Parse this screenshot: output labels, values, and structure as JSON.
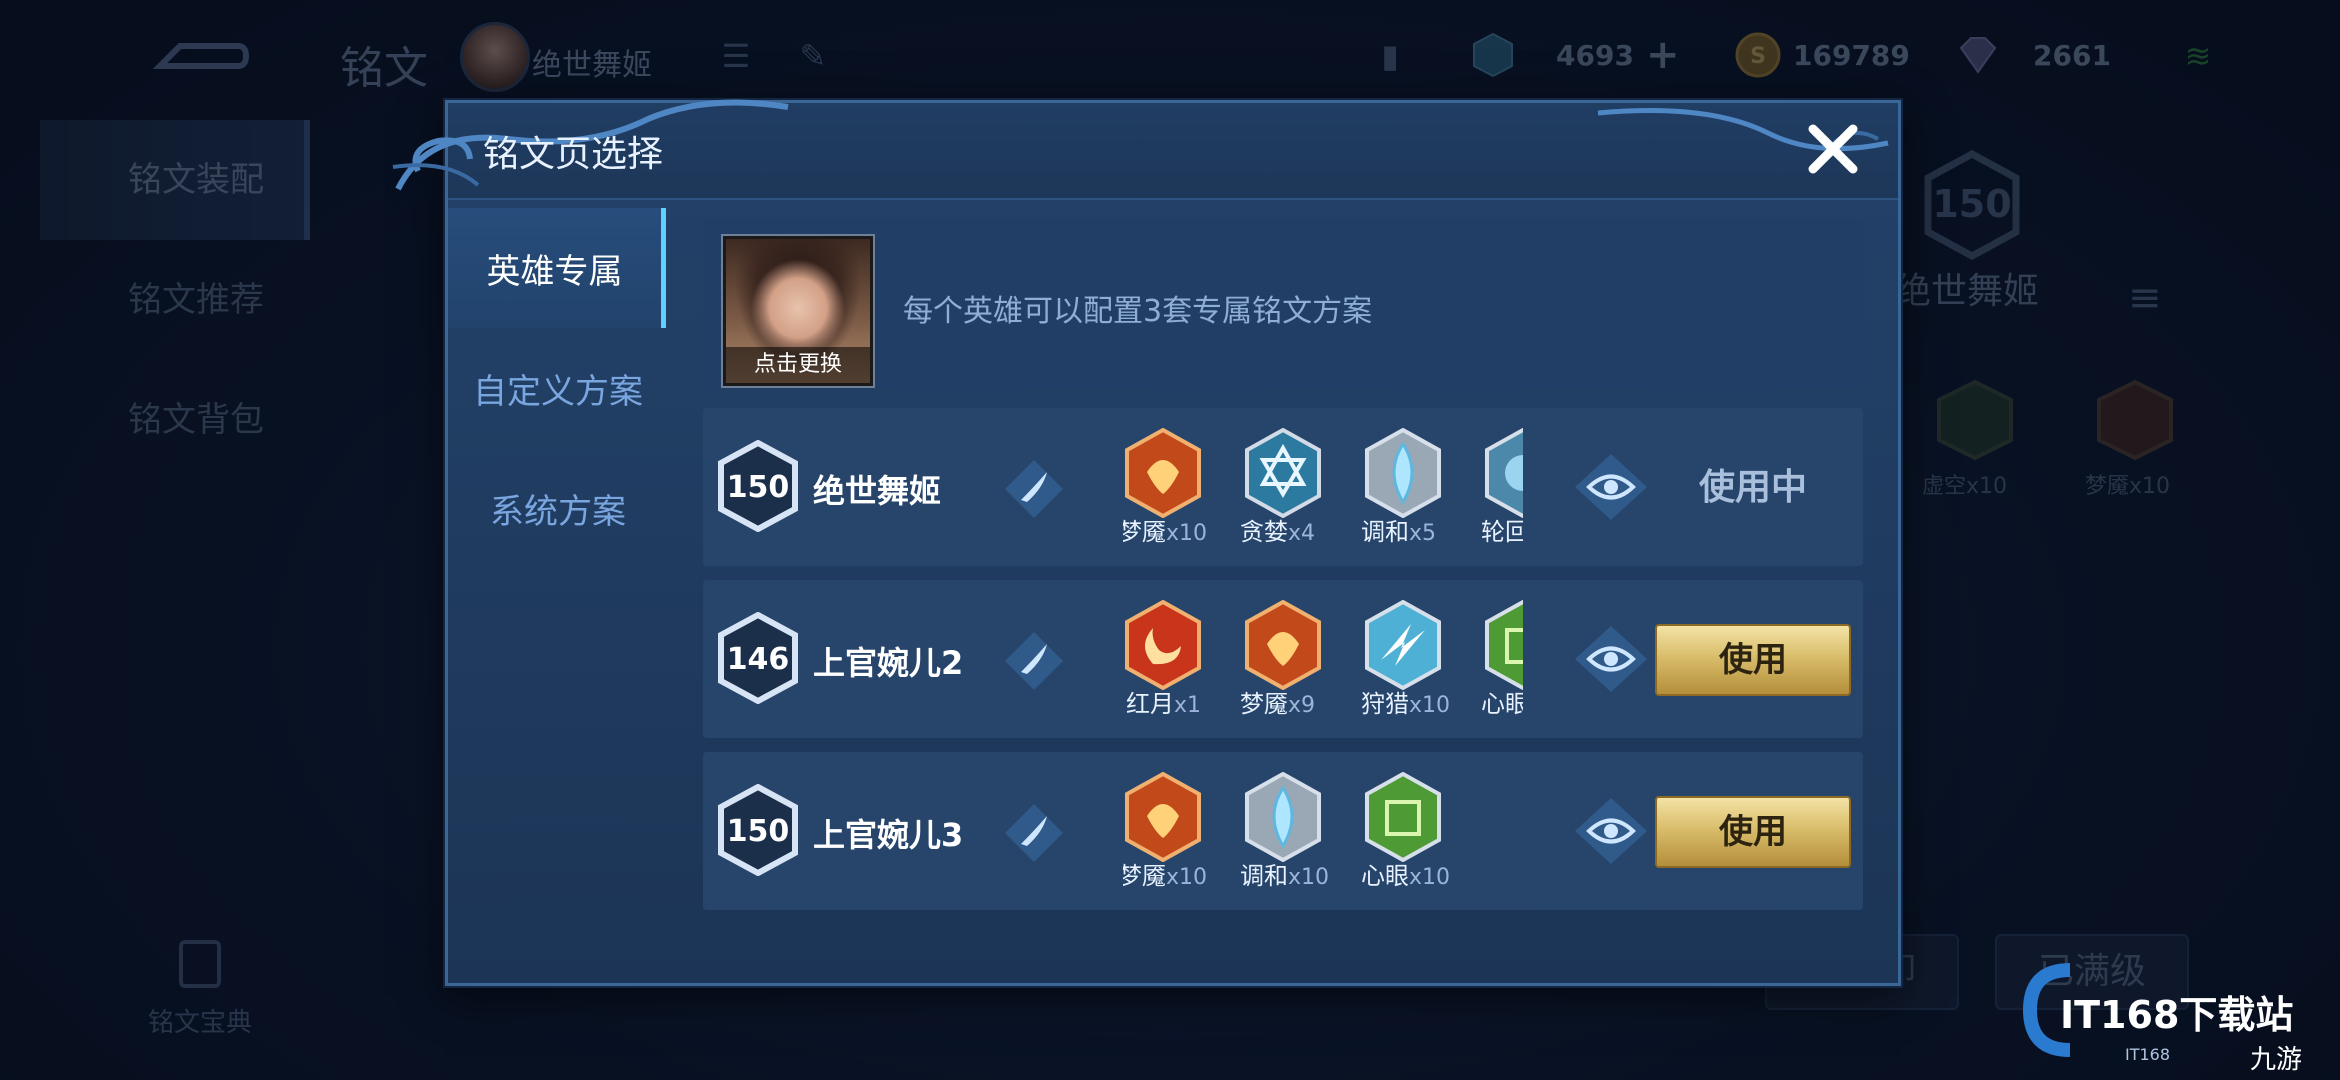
{
  "topbar": {
    "title": "铭文",
    "hero_name": "绝世舞姬",
    "currency": [
      {
        "icon": "hex-gem-icon",
        "value": "4693"
      },
      {
        "icon": "gold-coin-icon",
        "value": "169789"
      },
      {
        "icon": "diamond-icon",
        "value": "2661"
      }
    ]
  },
  "left_nav": {
    "items": [
      {
        "label": "铭文装配"
      },
      {
        "label": "铭文推荐"
      },
      {
        "label": "铭文背包"
      }
    ],
    "bottom_label": "铭文宝典"
  },
  "right_panel": {
    "level": "150",
    "hero_name": "绝世舞姬",
    "runes": [
      {
        "name": "虚空",
        "count": "x10"
      },
      {
        "name": "梦魇",
        "count": "x10"
      }
    ],
    "btn_unload": "一键卸",
    "btn_maxed": "已满级"
  },
  "dialog": {
    "title": "铭文页选择",
    "tabs": [
      {
        "label": "英雄专属"
      },
      {
        "label": "自定义方案"
      },
      {
        "label": "系统方案"
      }
    ],
    "hero_portrait_label": "点击更换",
    "hero_desc": "每个英雄可以配置3套专属铭文方案",
    "pages": [
      {
        "level": "150",
        "name": "绝世舞姬",
        "status": "使用中",
        "runes": [
          {
            "name": "梦魇",
            "count": "x10",
            "color": "#d8541f"
          },
          {
            "name": "贪婪",
            "count": "x4",
            "color": "#3a9ab8"
          },
          {
            "name": "调和",
            "count": "x5",
            "color": "#8fd3ec"
          },
          {
            "name": "轮回",
            "count": "",
            "color": "#6fb5d6"
          }
        ]
      },
      {
        "level": "146",
        "name": "上官婉儿2",
        "action": "使用",
        "runes": [
          {
            "name": "红月",
            "count": "x1",
            "color": "#e0421f"
          },
          {
            "name": "梦魇",
            "count": "x9",
            "color": "#d8541f"
          },
          {
            "name": "狩猎",
            "count": "x10",
            "color": "#6ec6e6"
          },
          {
            "name": "心眼",
            "count": "",
            "color": "#5aa23a"
          }
        ]
      },
      {
        "level": "150",
        "name": "上官婉儿3",
        "action": "使用",
        "runes": [
          {
            "name": "梦魇",
            "count": "x10",
            "color": "#d8541f"
          },
          {
            "name": "调和",
            "count": "x10",
            "color": "#8fd3ec"
          },
          {
            "name": "心眼",
            "count": "x10",
            "color": "#5aa23a"
          }
        ]
      }
    ]
  },
  "watermark": {
    "brand": "IT168下载站",
    "sub": "IT168",
    "tag": "九游"
  }
}
